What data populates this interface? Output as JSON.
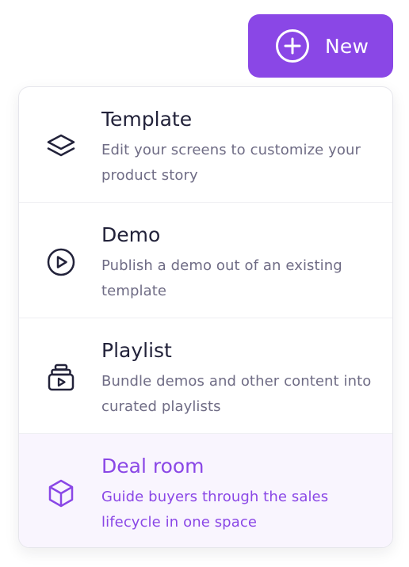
{
  "new_button": {
    "label": "New",
    "icon": "plus-circle-icon"
  },
  "menu": {
    "items": [
      {
        "title": "Template",
        "description": "Edit your screens to customize your product story",
        "icon": "layers-icon",
        "active": false
      },
      {
        "title": "Demo",
        "description": "Publish a demo out of an existing template",
        "icon": "play-circle-icon",
        "active": false
      },
      {
        "title": "Playlist",
        "description": "Bundle demos and other content into curated playlists",
        "icon": "playlist-icon",
        "active": false
      },
      {
        "title": "Deal room",
        "description": "Guide buyers through the sales lifecycle in one space",
        "icon": "cube-icon",
        "active": true
      }
    ]
  },
  "colors": {
    "accent": "#8a47e6",
    "title_text": "#22223a",
    "description_text": "#6f6c85",
    "active_background": "#f9f5fe"
  }
}
